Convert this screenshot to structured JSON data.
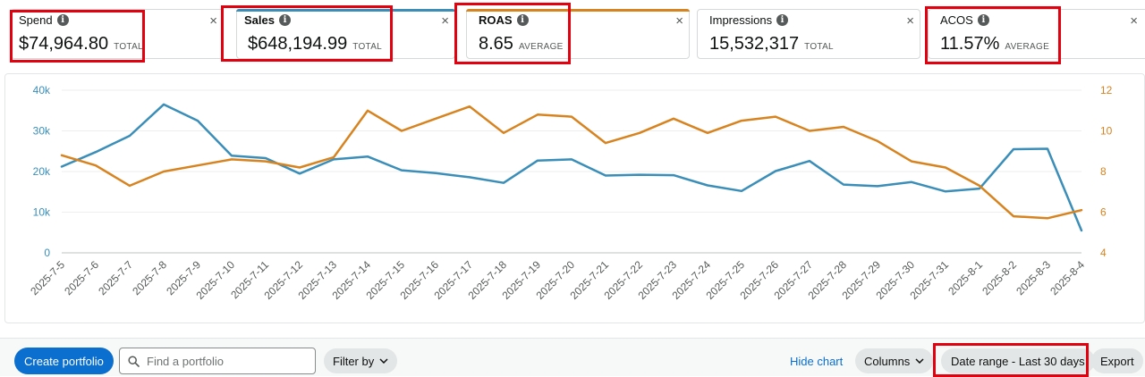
{
  "metrics": [
    {
      "label": "Spend",
      "value": "$74,964.80",
      "agg": "TOTAL",
      "selected": false
    },
    {
      "label": "Sales",
      "value": "$648,194.99",
      "agg": "TOTAL",
      "selected": true,
      "color": "#3a8eb8"
    },
    {
      "label": "ROAS",
      "value": "8.65",
      "agg": "AVERAGE",
      "selected": true,
      "color": "#d7831f"
    },
    {
      "label": "Impressions",
      "value": "15,532,317",
      "agg": "TOTAL",
      "selected": false
    },
    {
      "label": "ACOS",
      "value": "11.57%",
      "agg": "AVERAGE",
      "selected": false
    }
  ],
  "close_glyph": "×",
  "info_glyph": "i",
  "toolbar": {
    "create_label": "Create portfolio",
    "search_placeholder": "Find a portfolio",
    "filter_label": "Filter by",
    "hide_chart_label": "Hide chart",
    "columns_label": "Columns",
    "date_range_label": "Date range - Last 30 days",
    "export_label": "Export"
  },
  "chart_data": {
    "type": "line",
    "categories": [
      "2025-7-5",
      "2025-7-6",
      "2025-7-7",
      "2025-7-8",
      "2025-7-9",
      "2025-7-10",
      "2025-7-11",
      "2025-7-12",
      "2025-7-13",
      "2025-7-14",
      "2025-7-15",
      "2025-7-16",
      "2025-7-17",
      "2025-7-18",
      "2025-7-19",
      "2025-7-20",
      "2025-7-21",
      "2025-7-22",
      "2025-7-23",
      "2025-7-24",
      "2025-7-25",
      "2025-7-26",
      "2025-7-27",
      "2025-7-28",
      "2025-7-29",
      "2025-7-30",
      "2025-7-31",
      "2025-8-1",
      "2025-8-2",
      "2025-8-3",
      "2025-8-4"
    ],
    "series": [
      {
        "name": "Sales",
        "axis": "left",
        "color": "#3a8eb8",
        "values": [
          21200,
          24800,
          28800,
          36500,
          32500,
          23900,
          23300,
          19500,
          23000,
          23700,
          20300,
          19600,
          18600,
          17200,
          22700,
          23000,
          19000,
          19200,
          19100,
          16600,
          15200,
          20100,
          22600,
          16800,
          16400,
          17400,
          15100,
          15800,
          25500,
          25600,
          5500
        ]
      },
      {
        "name": "ROAS",
        "axis": "right",
        "color": "#d7831f",
        "values": [
          8.8,
          8.3,
          7.3,
          8.0,
          8.3,
          8.6,
          8.5,
          8.2,
          8.7,
          11.0,
          10.0,
          10.6,
          11.2,
          9.9,
          10.8,
          10.7,
          9.4,
          9.9,
          10.6,
          9.9,
          10.5,
          10.7,
          10.0,
          10.2,
          9.5,
          8.5,
          8.2,
          7.3,
          5.8,
          5.7,
          6.1
        ]
      }
    ],
    "y_left": {
      "ticks": [
        0,
        10000,
        20000,
        30000,
        40000
      ],
      "labels": [
        "0",
        "10k",
        "20k",
        "30k",
        "40k"
      ],
      "range": [
        0,
        40000
      ]
    },
    "y_right": {
      "ticks": [
        4,
        6,
        8,
        10,
        12
      ],
      "labels": [
        "4",
        "6",
        "8",
        "10",
        "12"
      ],
      "range": [
        4,
        12
      ]
    },
    "grid": true
  }
}
